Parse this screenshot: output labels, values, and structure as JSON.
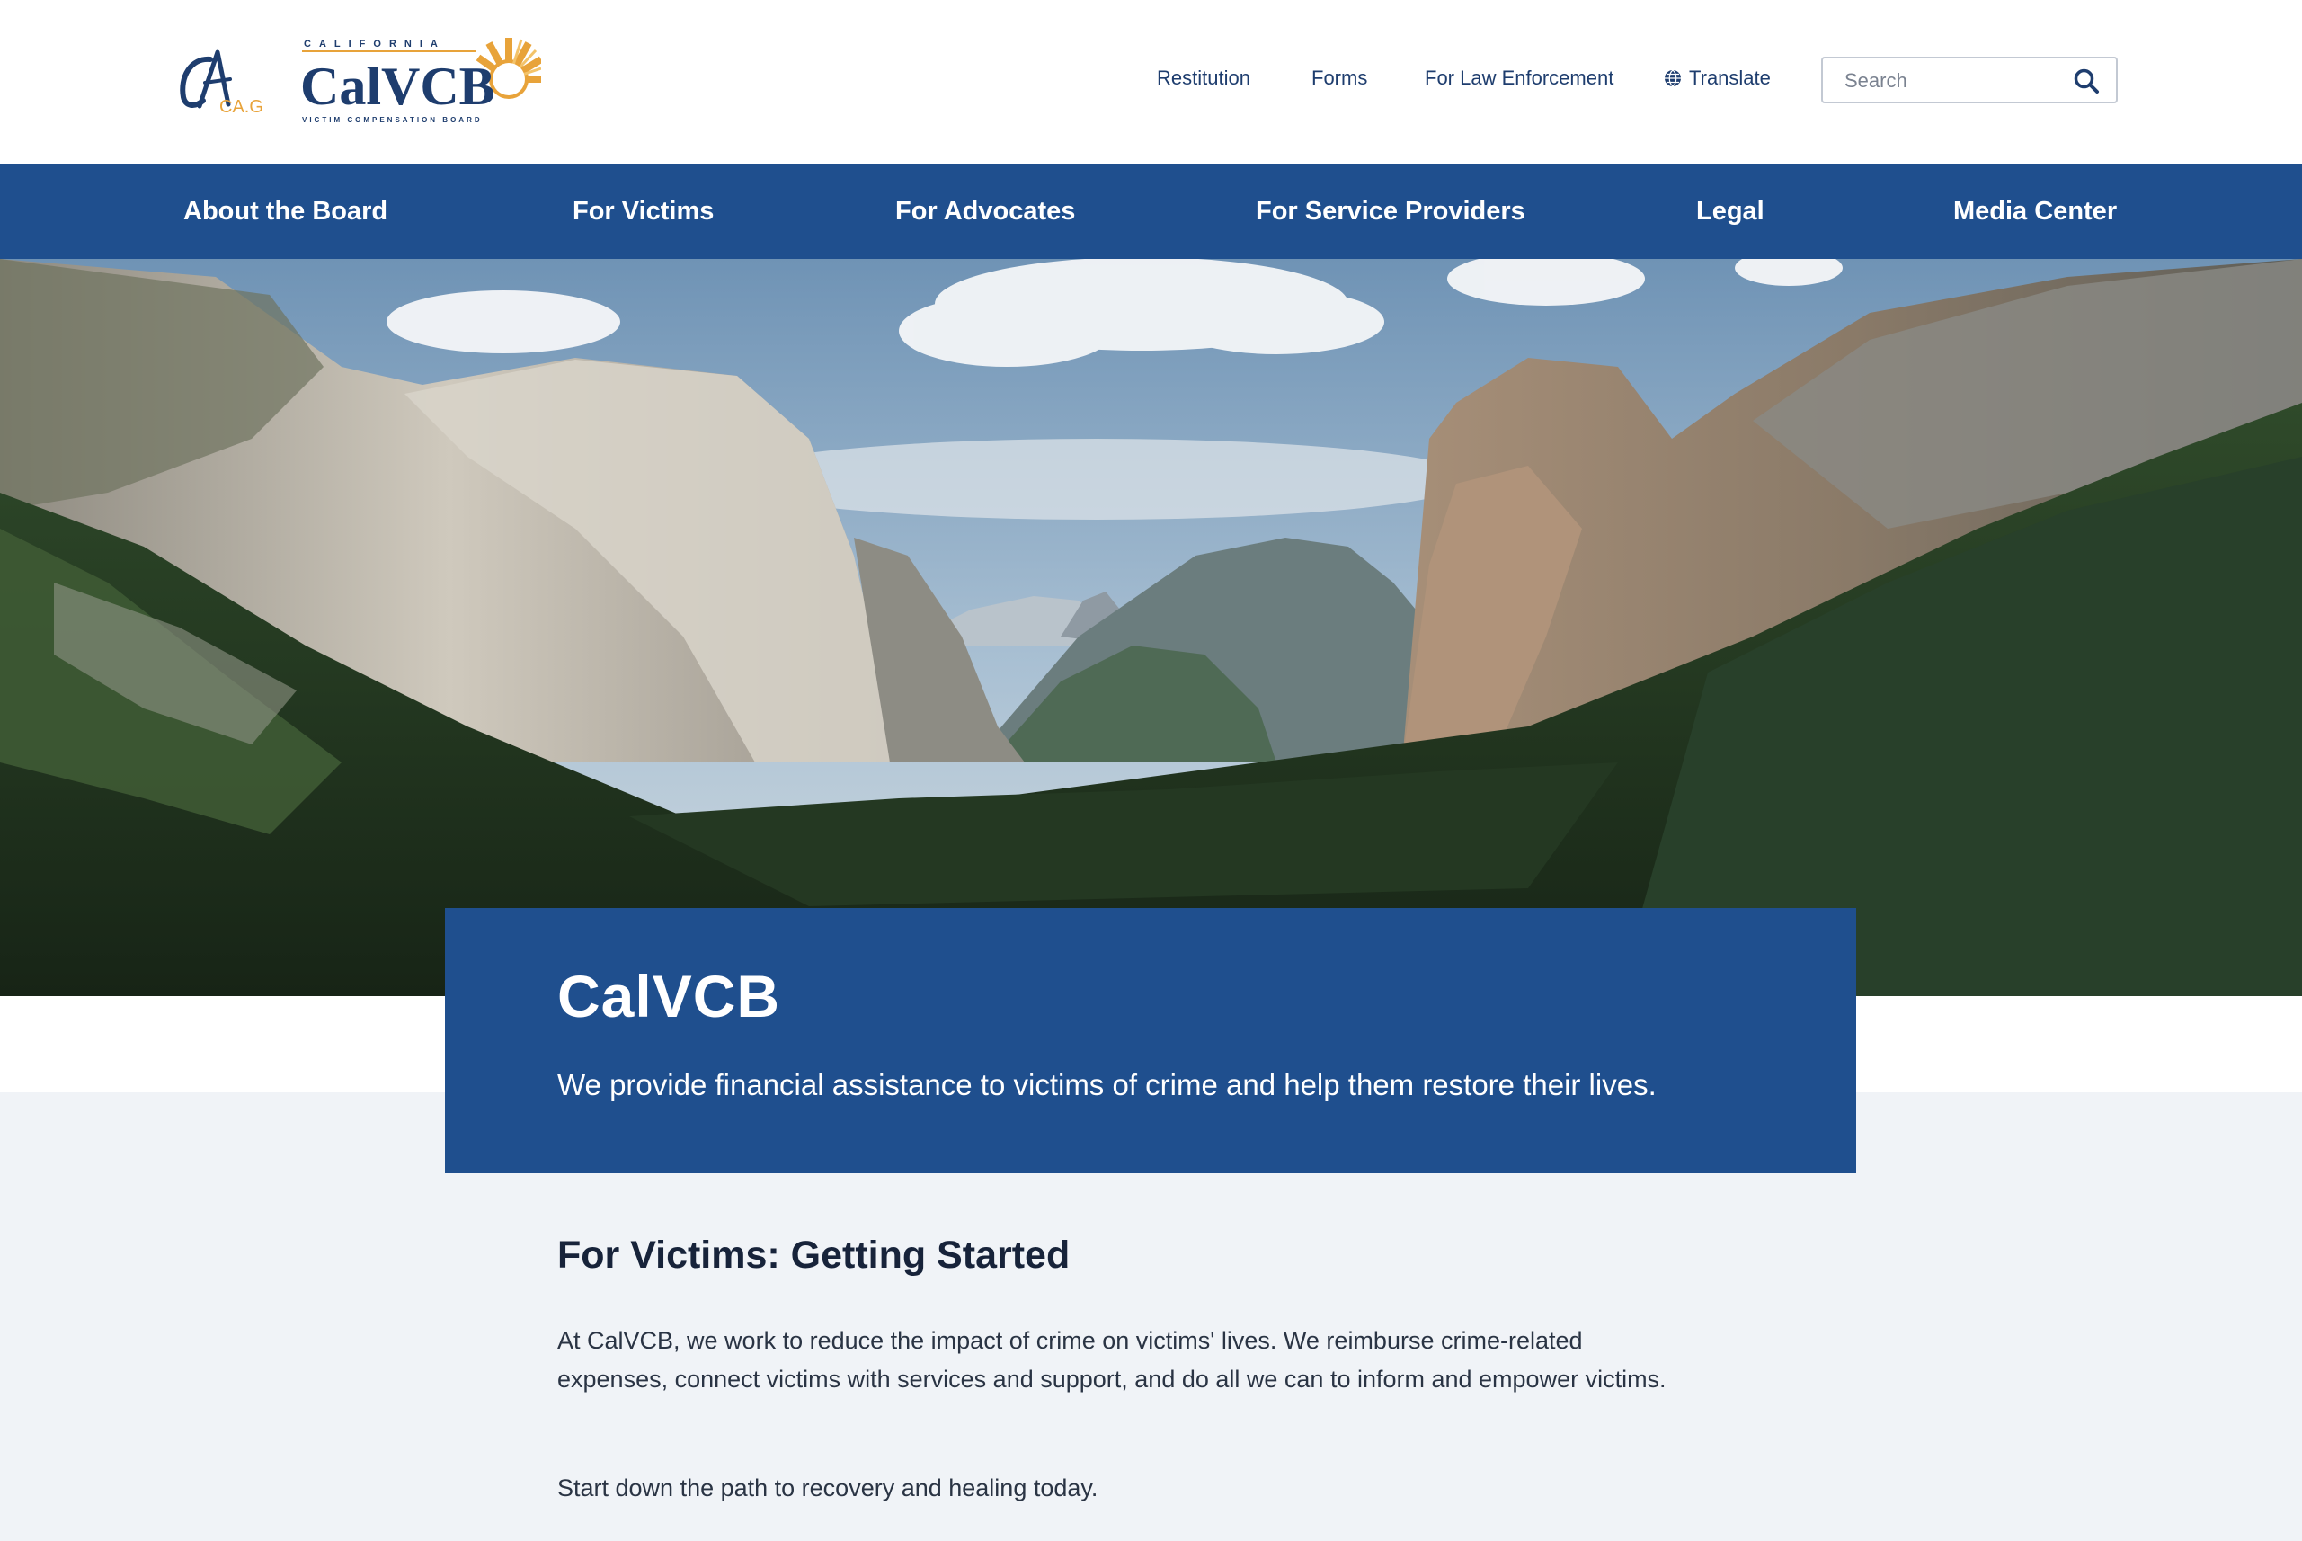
{
  "header": {
    "ca_logo_label": "CA.GOV",
    "logo": {
      "top_text": "CALIFORNIA",
      "name": "CalVCB",
      "bottom_text": "VICTIM COMPENSATION BOARD"
    },
    "utility_links": {
      "restitution": "Restitution",
      "forms": "Forms",
      "law_enforcement": "For Law Enforcement",
      "translate": "Translate"
    },
    "search": {
      "placeholder": "Search"
    }
  },
  "nav": {
    "items": [
      "About the Board",
      "For Victims",
      "For Advocates",
      "For Service Providers",
      "Legal",
      "Media Center"
    ]
  },
  "hero": {
    "title": "CalVCB",
    "subtitle": "We provide financial assistance to victims of crime and help them restore their lives."
  },
  "section": {
    "title": "For Victims: Getting Started",
    "body": "At CalVCB, we work to reduce the impact of crime on victims' lives. We reimburse crime-related expenses, connect victims with services and support, and do all we can to inform and empower victims.",
    "cta": "Start down the path to recovery and healing today."
  },
  "colors": {
    "brand_blue": "#1f4f8e",
    "logo_gold": "#e8a33a",
    "page_bg": "#f0f3f7"
  },
  "icons": {
    "search": "search-icon",
    "translate": "globe-icon"
  }
}
